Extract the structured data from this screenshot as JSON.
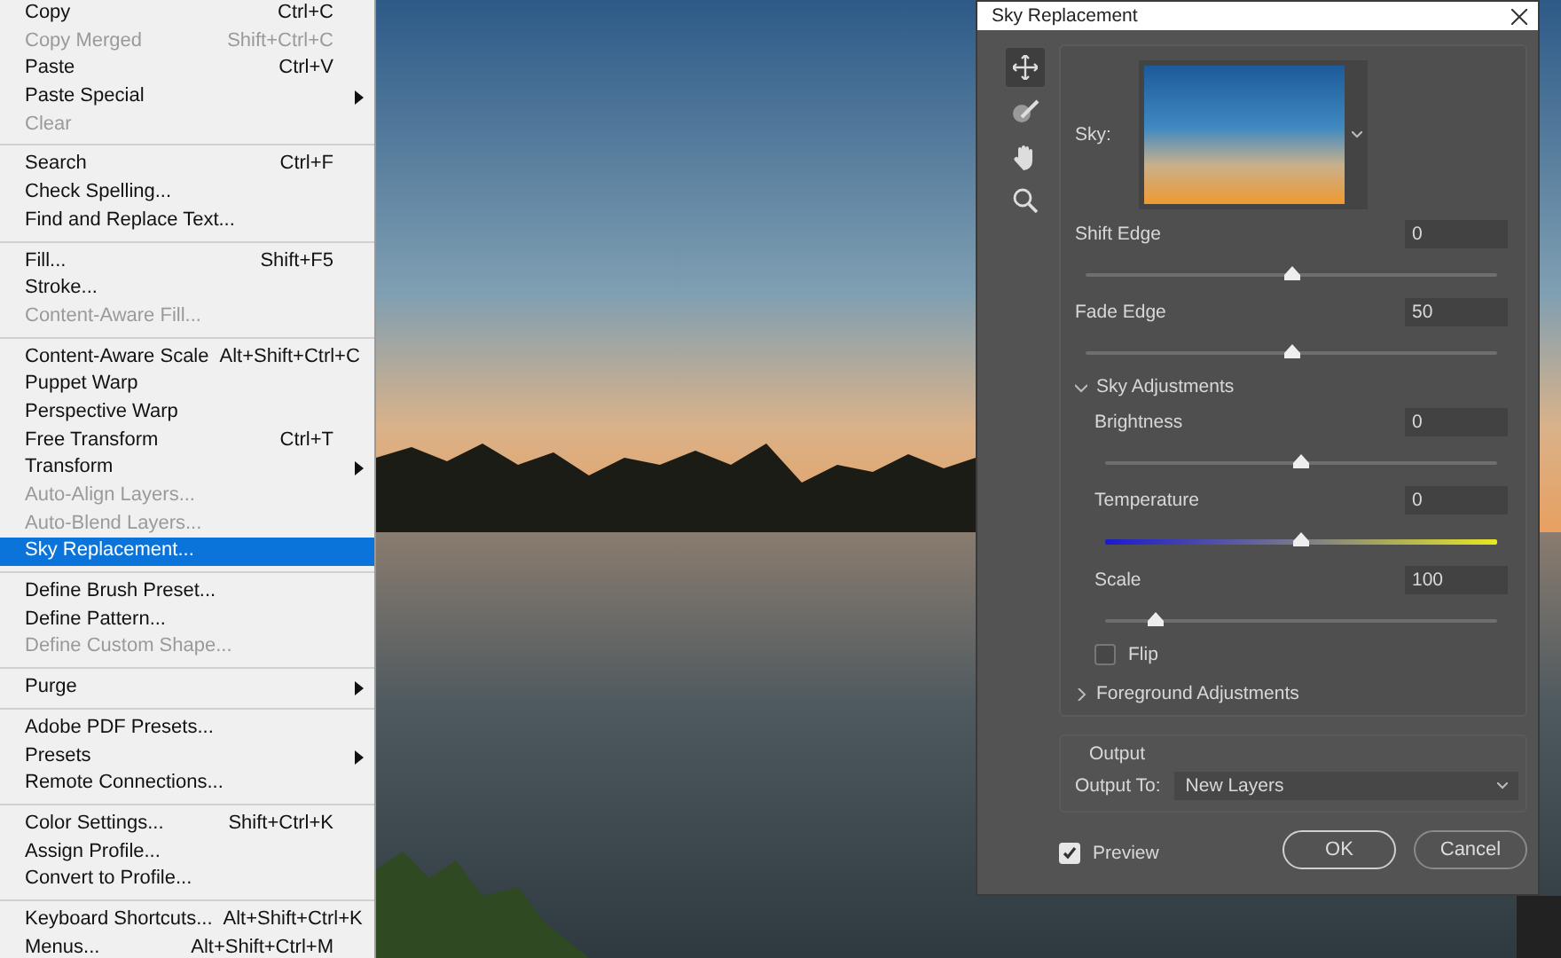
{
  "menu": {
    "groups": [
      {
        "items": [
          {
            "label": "Copy",
            "shortcut": "Ctrl+C",
            "submenu": false,
            "disabled": false,
            "selected": false
          },
          {
            "label": "Copy Merged",
            "shortcut": "Shift+Ctrl+C",
            "submenu": false,
            "disabled": true,
            "selected": false
          },
          {
            "label": "Paste",
            "shortcut": "Ctrl+V",
            "submenu": false,
            "disabled": false,
            "selected": false
          },
          {
            "label": "Paste Special",
            "submenu": true,
            "disabled": false,
            "selected": false
          },
          {
            "label": "Clear",
            "submenu": false,
            "disabled": true,
            "selected": false
          }
        ]
      },
      {
        "items": [
          {
            "label": "Search",
            "shortcut": "Ctrl+F",
            "submenu": false,
            "disabled": false,
            "selected": false
          },
          {
            "label": "Check Spelling...",
            "submenu": false,
            "disabled": false,
            "selected": false
          },
          {
            "label": "Find and Replace Text...",
            "submenu": false,
            "disabled": false,
            "selected": false
          }
        ]
      },
      {
        "items": [
          {
            "label": "Fill...",
            "shortcut": "Shift+F5",
            "submenu": false,
            "disabled": false,
            "selected": false
          },
          {
            "label": "Stroke...",
            "submenu": false,
            "disabled": false,
            "selected": false
          },
          {
            "label": "Content-Aware Fill...",
            "submenu": false,
            "disabled": true,
            "selected": false
          }
        ]
      },
      {
        "items": [
          {
            "label": "Content-Aware Scale",
            "shortcut": "Alt+Shift+Ctrl+C",
            "submenu": false,
            "disabled": false,
            "selected": false
          },
          {
            "label": "Puppet Warp",
            "submenu": false,
            "disabled": false,
            "selected": false
          },
          {
            "label": "Perspective Warp",
            "submenu": false,
            "disabled": false,
            "selected": false
          },
          {
            "label": "Free Transform",
            "shortcut": "Ctrl+T",
            "submenu": false,
            "disabled": false,
            "selected": false
          },
          {
            "label": "Transform",
            "submenu": true,
            "disabled": false,
            "selected": false
          },
          {
            "label": "Auto-Align Layers...",
            "submenu": false,
            "disabled": true,
            "selected": false
          },
          {
            "label": "Auto-Blend Layers...",
            "submenu": false,
            "disabled": true,
            "selected": false
          },
          {
            "label": "Sky Replacement...",
            "submenu": false,
            "disabled": false,
            "selected": true
          }
        ]
      },
      {
        "items": [
          {
            "label": "Define Brush Preset...",
            "submenu": false,
            "disabled": false,
            "selected": false
          },
          {
            "label": "Define Pattern...",
            "submenu": false,
            "disabled": false,
            "selected": false
          },
          {
            "label": "Define Custom Shape...",
            "submenu": false,
            "disabled": true,
            "selected": false
          }
        ]
      },
      {
        "items": [
          {
            "label": "Purge",
            "submenu": true,
            "disabled": false,
            "selected": false
          }
        ]
      },
      {
        "items": [
          {
            "label": "Adobe PDF Presets...",
            "submenu": false,
            "disabled": false,
            "selected": false
          },
          {
            "label": "Presets",
            "submenu": true,
            "disabled": false,
            "selected": false
          },
          {
            "label": "Remote Connections...",
            "submenu": false,
            "disabled": false,
            "selected": false
          }
        ]
      },
      {
        "items": [
          {
            "label": "Color Settings...",
            "shortcut": "Shift+Ctrl+K",
            "submenu": false,
            "disabled": false,
            "selected": false
          },
          {
            "label": "Assign Profile...",
            "submenu": false,
            "disabled": false,
            "selected": false
          },
          {
            "label": "Convert to Profile...",
            "submenu": false,
            "disabled": false,
            "selected": false
          }
        ]
      },
      {
        "items": [
          {
            "label": "Keyboard Shortcuts...",
            "shortcut": "Alt+Shift+Ctrl+K",
            "submenu": false,
            "disabled": false,
            "selected": false
          },
          {
            "label": "Menus...",
            "shortcut": "Alt+Shift+Ctrl+M",
            "submenu": false,
            "disabled": false,
            "selected": false
          }
        ]
      }
    ]
  },
  "dialog": {
    "title": "Sky Replacement",
    "tools": [
      {
        "kind": "move",
        "selected": true
      },
      {
        "kind": "brush",
        "selected": false
      },
      {
        "kind": "hand",
        "selected": false
      },
      {
        "kind": "zoom",
        "selected": false
      }
    ],
    "sky_label": "Sky:",
    "edge_sliders": [
      {
        "label": "Shift Edge",
        "value": "0",
        "level": 0.5,
        "kind": "plain"
      },
      {
        "label": "Fade Edge",
        "value": "50",
        "level": 0.5,
        "kind": "plain"
      }
    ],
    "sky_adjustments": {
      "label": "Sky Adjustments",
      "expanded": true,
      "sliders": [
        {
          "label": "Brightness",
          "value": "0",
          "level": 0.5,
          "kind": "plain"
        },
        {
          "label": "Temperature",
          "value": "0",
          "level": 0.5,
          "kind": "temperature"
        },
        {
          "label": "Scale",
          "value": "100",
          "level": 0.13,
          "kind": "plain"
        }
      ],
      "flip": {
        "label": "Flip",
        "checked": false
      }
    },
    "foreground_adjustments": {
      "label": "Foreground Adjustments",
      "expanded": false
    },
    "output": {
      "title": "Output",
      "label": "Output To:",
      "value": "New Layers"
    },
    "preview": {
      "label": "Preview",
      "checked": true
    },
    "buttons": [
      {
        "label": "OK",
        "default": true
      },
      {
        "label": "Cancel",
        "default": false
      }
    ]
  }
}
